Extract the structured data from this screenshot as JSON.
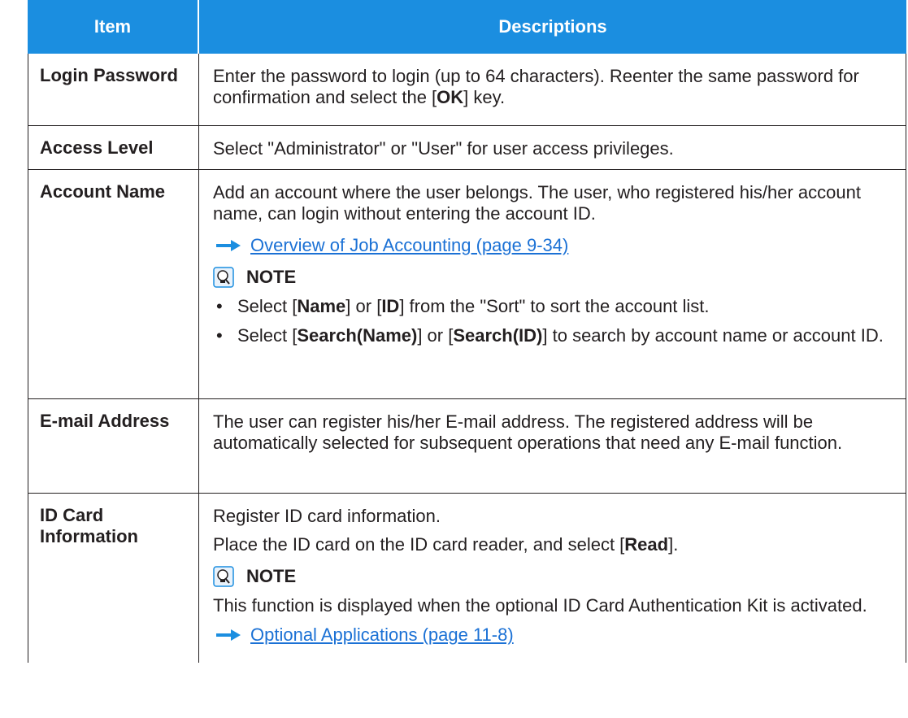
{
  "header": {
    "item": "Item",
    "descriptions": "Descriptions"
  },
  "colors": {
    "header_bg": "#1b8ee0",
    "link": "#1b71d5",
    "arrow": "#1b8ee0"
  },
  "rows": {
    "login": {
      "item": "Login Password",
      "text_a": "Enter the password to login (up to 64 characters). Reenter the same password for confirmation and select the [",
      "key": "OK",
      "text_b": "] key."
    },
    "access": {
      "item": "Access Level",
      "text": "Select \"Administrator\" or \"User\" for user access privileges."
    },
    "account": {
      "item": "Account Name",
      "text": "Add an account where the user belongs. The user, who registered his/her account name, can login without entering the account ID.",
      "link": "Overview of Job Accounting (page 9-34)",
      "note_label": "NOTE",
      "bullets": [
        {
          "a": "Select [",
          "k1": "Name",
          "b": "] or [",
          "k2": "ID",
          "c": "] from the \"Sort\" to sort the account list."
        },
        {
          "a": "Select [",
          "k1": "Search(Name)",
          "b": "] or [",
          "k2": "Search(ID)",
          "c": "] to search by account name or account ID."
        }
      ]
    },
    "email": {
      "item": "E-mail Address",
      "text": "The user can register his/her E-mail address. The registered address will be automatically selected for subsequent operations that need any E-mail function."
    },
    "idcard": {
      "item": "ID Card Information",
      "text1": "Register ID card information.",
      "text2_a": "Place the ID card on the ID card reader, and select [",
      "key": "Read",
      "text2_b": "].",
      "note_label": "NOTE",
      "note_text": "This function is displayed when the optional ID Card Authentication Kit is activated.",
      "link": "Optional Applications (page 11-8)"
    }
  },
  "icons": {
    "arrow": "right-arrow-icon",
    "note": "note-lightbulb-icon"
  }
}
